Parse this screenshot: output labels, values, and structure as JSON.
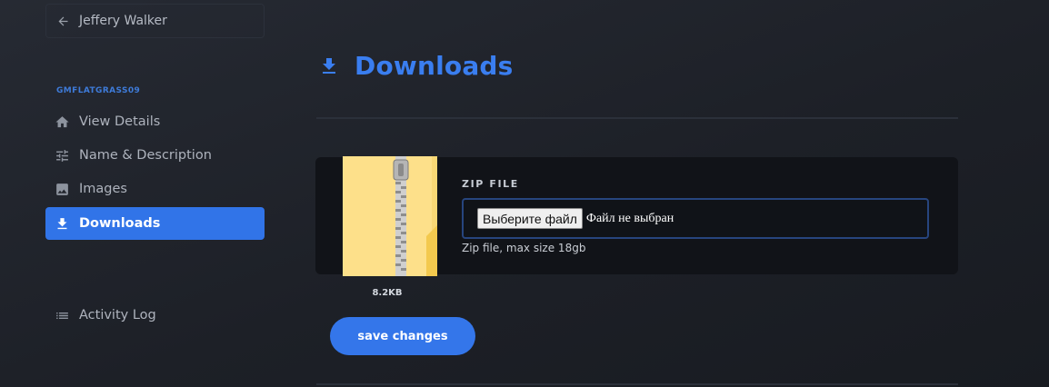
{
  "sidebar": {
    "back_label": "Jeffery Walker",
    "section_label": "GMFLATGRASS09",
    "items": [
      {
        "label": "View Details",
        "icon": "home-icon"
      },
      {
        "label": "Name & Description",
        "icon": "sliders-icon"
      },
      {
        "label": "Images",
        "icon": "image-icon"
      },
      {
        "label": "Downloads",
        "icon": "download-icon",
        "active": true
      }
    ],
    "activity_label": "Activity Log"
  },
  "main": {
    "title": "Downloads",
    "upload": {
      "file_size": "8.2KB",
      "field_label": "ZIP FILE",
      "choose_label": "Выберите файл",
      "no_file_label": "Файл не выбран",
      "hint": "Zip file, max size 18gb"
    },
    "save_label": "save changes"
  },
  "colors": {
    "accent": "#3174e8",
    "title": "#3a7ef0",
    "card": "#111318",
    "background": "#1d2027"
  }
}
